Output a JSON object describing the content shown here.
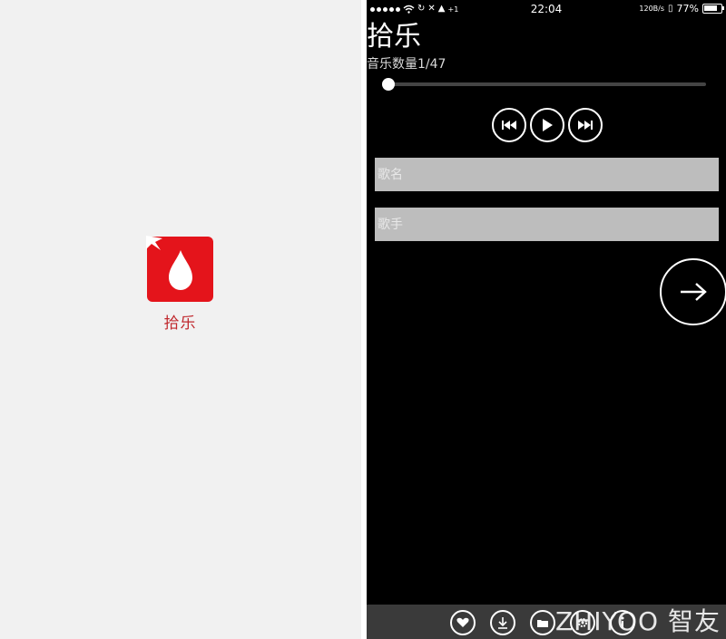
{
  "splash": {
    "app_name": "拾乐",
    "icon": "water-drop-icon",
    "colors": {
      "background": "#f1f1f1",
      "icon": "#e4141b",
      "label": "#c0282d"
    }
  },
  "status_bar": {
    "carrier_icons": [
      "signal-dots",
      "wifi-icon",
      "sync-icon",
      "mute-icon",
      "bell-icon"
    ],
    "extra": "+1",
    "time": "22:04",
    "net_speed": "120B/s",
    "battery": "77%",
    "battery_level": 0.77
  },
  "player": {
    "title": "拾乐",
    "song_count": "音乐数量1/47",
    "progress": 0.0,
    "controls": [
      "previous-icon",
      "play-icon",
      "next-icon"
    ],
    "song_input": {
      "placeholder": "歌名",
      "value": ""
    },
    "singer_input": {
      "placeholder": "歌手",
      "value": ""
    },
    "go_icon": "arrow-right-icon",
    "tabs": [
      "heart-icon",
      "download-icon",
      "folder-icon",
      "settings-icon",
      "info-icon"
    ],
    "colors": {
      "background": "#000000",
      "input": "#bdbdbd",
      "tabbar": "#3a3a3a"
    }
  },
  "watermark": "ZHIYOO 智友"
}
